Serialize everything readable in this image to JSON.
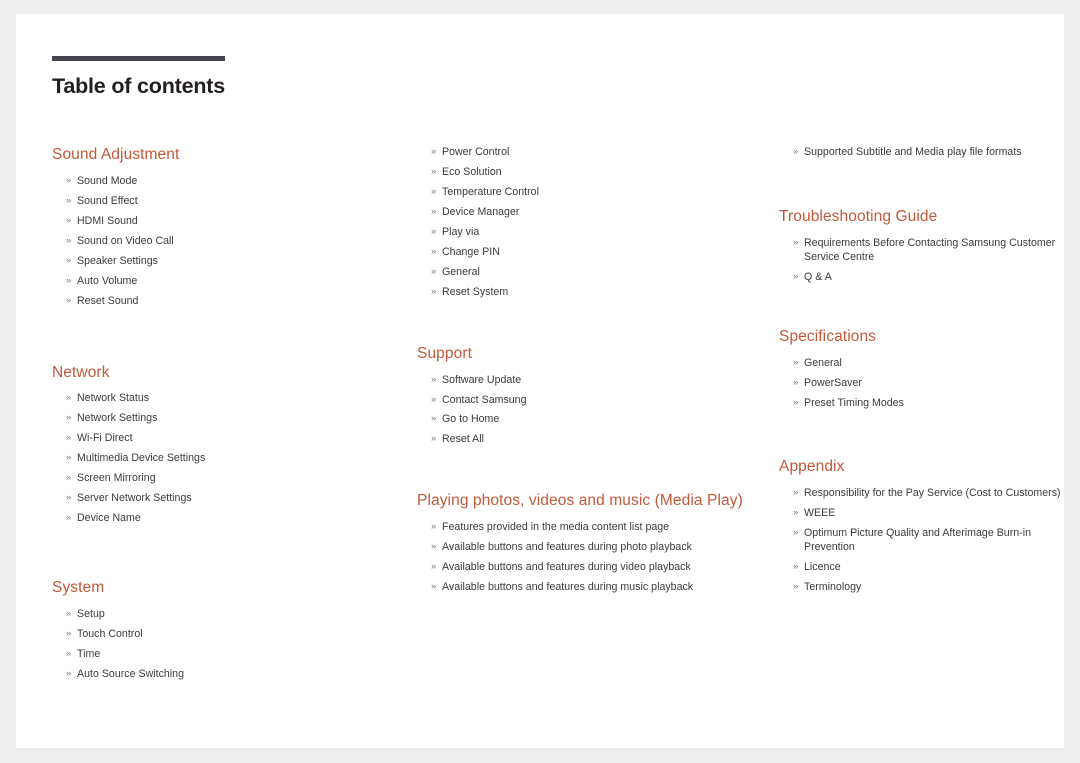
{
  "document": {
    "title": "Table of contents"
  },
  "bullet_glyph": "»",
  "colors": {
    "section_heading": "#c2593a",
    "body_text": "#3b3b3b",
    "title_rule": "#46454f",
    "page_background": "#ffffff",
    "canvas_background": "#efefef"
  },
  "columns": [
    {
      "id": "column-1",
      "sections": [
        {
          "title": "Sound Adjustment",
          "entries": [
            "Sound Mode",
            "Sound Effect",
            "HDMI Sound",
            "Sound on Video Call",
            "Speaker Settings",
            "Auto Volume",
            "Reset Sound"
          ]
        },
        {
          "title": "Network",
          "entries": [
            "Network Status",
            "Network Settings",
            "Wi-Fi Direct",
            "Multimedia Device Settings",
            "Screen Mirroring",
            "Server Network Settings",
            "Device Name"
          ]
        },
        {
          "title": "System",
          "entries": [
            "Setup",
            "Touch Control",
            "Time",
            "Auto Source Switching"
          ]
        }
      ]
    },
    {
      "id": "column-2",
      "sections": [
        {
          "title": "",
          "entries": [
            "Power Control",
            "Eco Solution",
            "Temperature Control",
            "Device Manager",
            "Play via",
            "Change PIN",
            "General",
            "Reset System"
          ]
        },
        {
          "title": "Support",
          "entries": [
            "Software Update",
            "Contact Samsung",
            "Go to Home",
            "Reset All"
          ]
        },
        {
          "title": "Playing photos, videos and music (Media Play)",
          "entries": [
            "Features provided in the media content list page",
            "Available buttons and features during photo playback",
            "Available buttons and features during video playback",
            "Available buttons and features during music playback"
          ]
        }
      ]
    },
    {
      "id": "column-3",
      "sections": [
        {
          "title": "",
          "entries": [
            "Supported Subtitle and Media play file formats"
          ]
        },
        {
          "title": "Troubleshooting Guide",
          "entries": [
            "Requirements Before Contacting Samsung Customer Service Centre",
            "Q & A"
          ]
        },
        {
          "title": "Specifications",
          "entries": [
            "General",
            "PowerSaver",
            "Preset Timing Modes"
          ]
        },
        {
          "title": "Appendix",
          "entries": [
            "Responsibility for the Pay Service (Cost to Customers)",
            "WEEE",
            "Optimum Picture Quality and Afterimage Burn-in Prevention",
            "Licence",
            "Terminology"
          ]
        }
      ]
    }
  ]
}
